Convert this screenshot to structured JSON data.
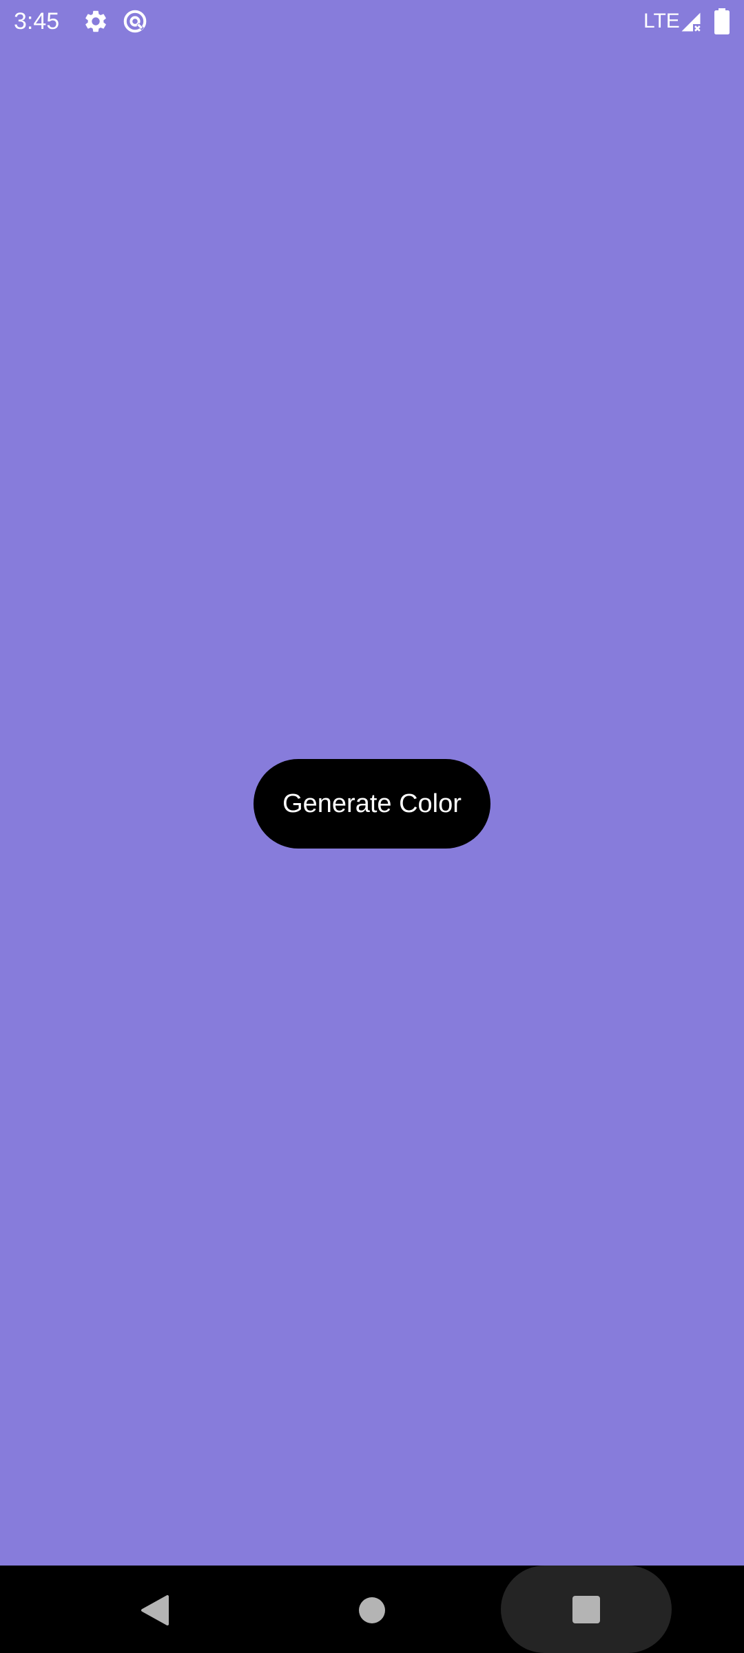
{
  "status_bar": {
    "time": "3:45",
    "network": "LTE",
    "icons": [
      "settings-icon",
      "data-saver-icon",
      "signal-icon",
      "battery-icon"
    ]
  },
  "main": {
    "background_color": "#877cdb",
    "generate_button_label": "Generate Color"
  },
  "nav_bar": {
    "buttons": [
      "back",
      "home",
      "recents"
    ]
  }
}
